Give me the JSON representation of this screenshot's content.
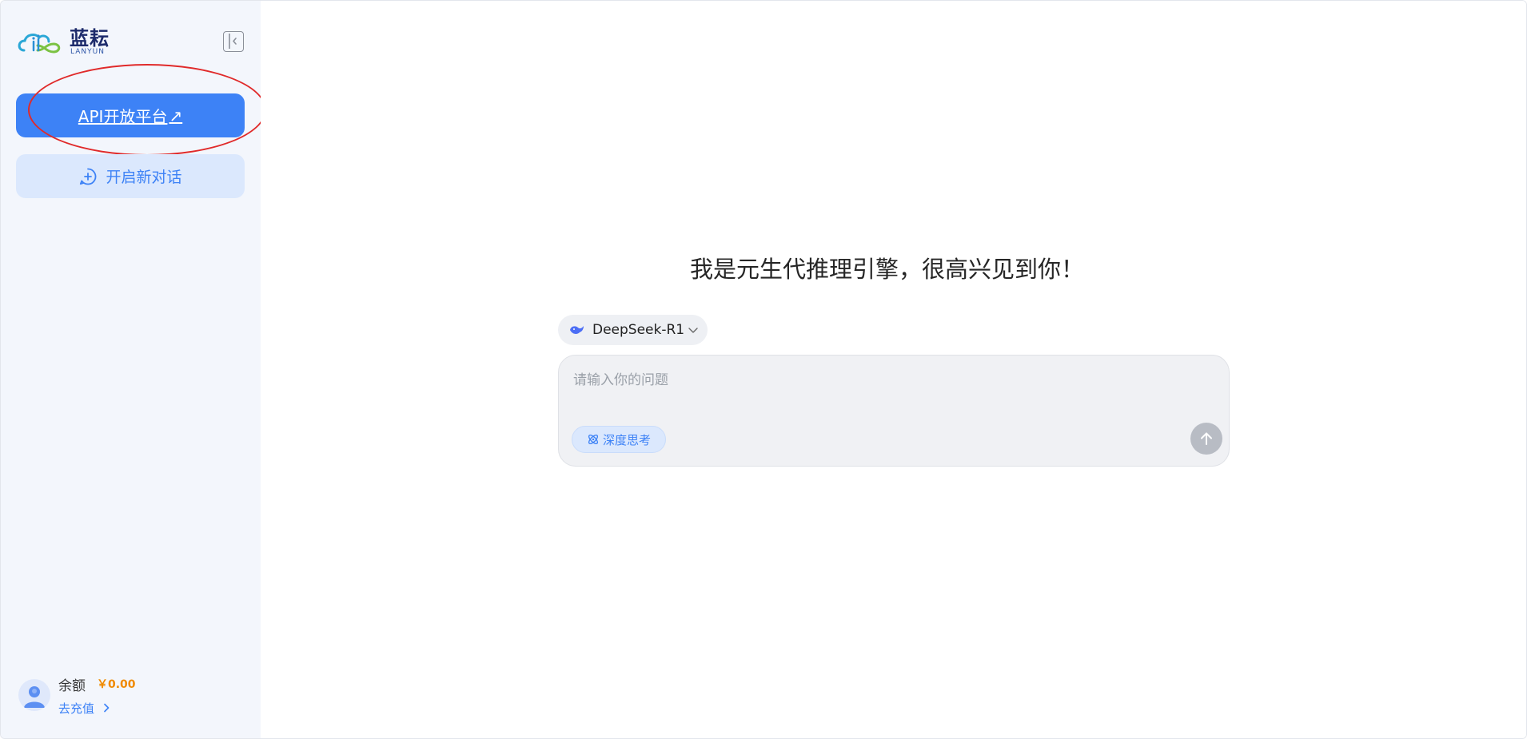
{
  "brand": {
    "name": "蓝耘",
    "sub": "LANYUN"
  },
  "sidebar": {
    "api_button": {
      "label": "API开放平台",
      "arrow": "↗"
    },
    "new_chat_button": {
      "label": "开启新对话"
    },
    "account": {
      "balance_label": "余额",
      "balance_value": "￥0.00",
      "recharge_label": "去充值"
    }
  },
  "main": {
    "greeting": "我是元生代推理引擎，很高兴见到你！",
    "model_select": {
      "value": "DeepSeek-R1"
    },
    "chat": {
      "placeholder": "请输入你的问题",
      "deep_think_label": "深度思考"
    }
  },
  "colors": {
    "accent": "#3d82f6",
    "sidebar_bg": "#f3f6fc",
    "highlight": "#e02a2a",
    "balance": "#f08a00"
  },
  "icons": [
    "lanyun-logo",
    "sidebar-collapse-icon",
    "external-link-icon",
    "chat-plus-icon",
    "whale-icon",
    "chevron-down-icon",
    "atom-icon",
    "arrow-up-icon",
    "user-avatar-icon",
    "chevron-right-icon"
  ]
}
